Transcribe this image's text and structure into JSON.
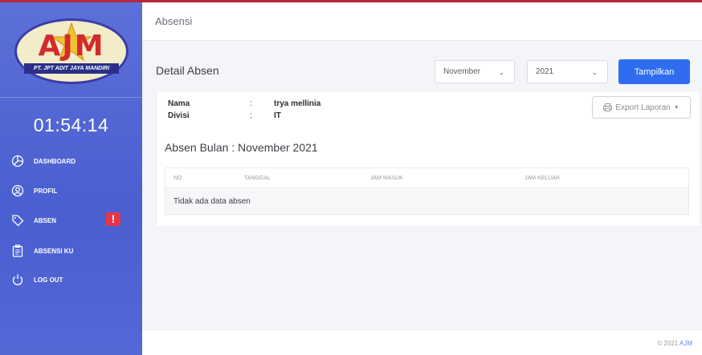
{
  "colors": {
    "sidebar": "#4a5fd0",
    "primary_button": "#2f6df0",
    "alert": "#e6344a",
    "accent_link": "#5b8ef0"
  },
  "brand": {
    "logo_letters": "AJM",
    "logo_subtitle": "PT. JPT ADIT JAYA MANDIRI"
  },
  "sidebar": {
    "clock": "01:54:14",
    "items": [
      {
        "label": "DASHBOARD",
        "icon": "pie-chart-icon"
      },
      {
        "label": "PROFIL",
        "icon": "user-icon"
      },
      {
        "label": "ABSEN",
        "icon": "tag-icon",
        "badge": "!"
      },
      {
        "label": "ABSENSI KU",
        "icon": "clipboard-icon"
      },
      {
        "label": "LOG OUT",
        "icon": "power-icon"
      }
    ]
  },
  "header": {
    "title": "Absensi"
  },
  "detail": {
    "title": "Detail Absen",
    "month_select": "November",
    "year_select": "2021",
    "show_button": "Tampilkan",
    "export_button": "Export Laporan",
    "info": [
      {
        "label": "Nama",
        "colon": ":",
        "value": "trya mellinia"
      },
      {
        "label": "Divisi",
        "colon": ":",
        "value": "IT"
      }
    ],
    "absen_title": "Absen Bulan : November 2021",
    "table": {
      "columns": [
        "NO",
        "TANGGAL",
        "JAM MASUK",
        "JAM KELUAR"
      ],
      "empty_message": "Tidak ada data absen"
    }
  },
  "footer": {
    "copyright": "© 2021 ",
    "brand_link": "AJM"
  }
}
